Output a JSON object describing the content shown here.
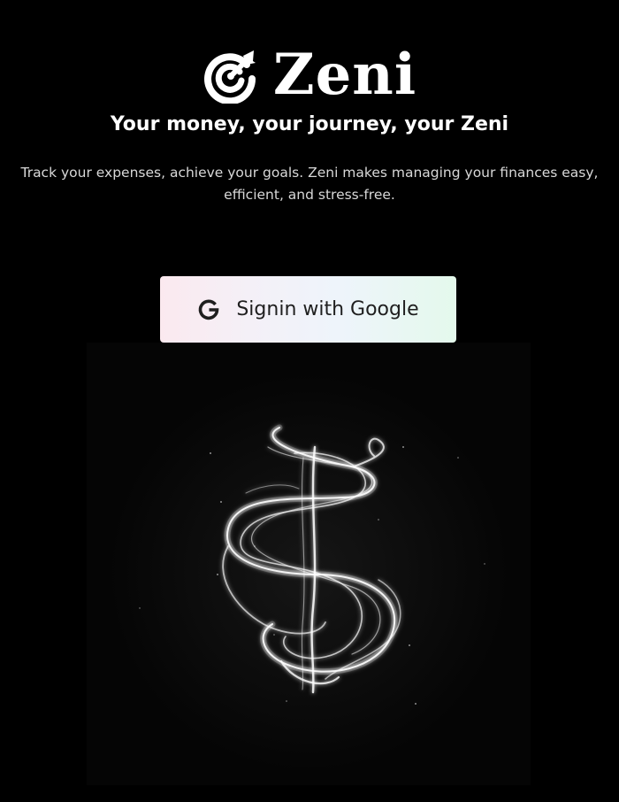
{
  "brand": {
    "name": "Zeni",
    "logo_icon": "target-arrow-icon"
  },
  "hero": {
    "tagline": "Your money, your journey, your Zeni",
    "description": "Track your expenses, achieve your goals. Zeni makes managing your finances easy, efficient, and stress-free.",
    "illustration": "dollar-sign-smoke-icon"
  },
  "auth": {
    "google_button_label": "Signin with Google",
    "google_icon": "google-g-icon"
  },
  "colors": {
    "background": "#000000",
    "text": "#ffffff",
    "button_text": "#1f1f1f"
  }
}
